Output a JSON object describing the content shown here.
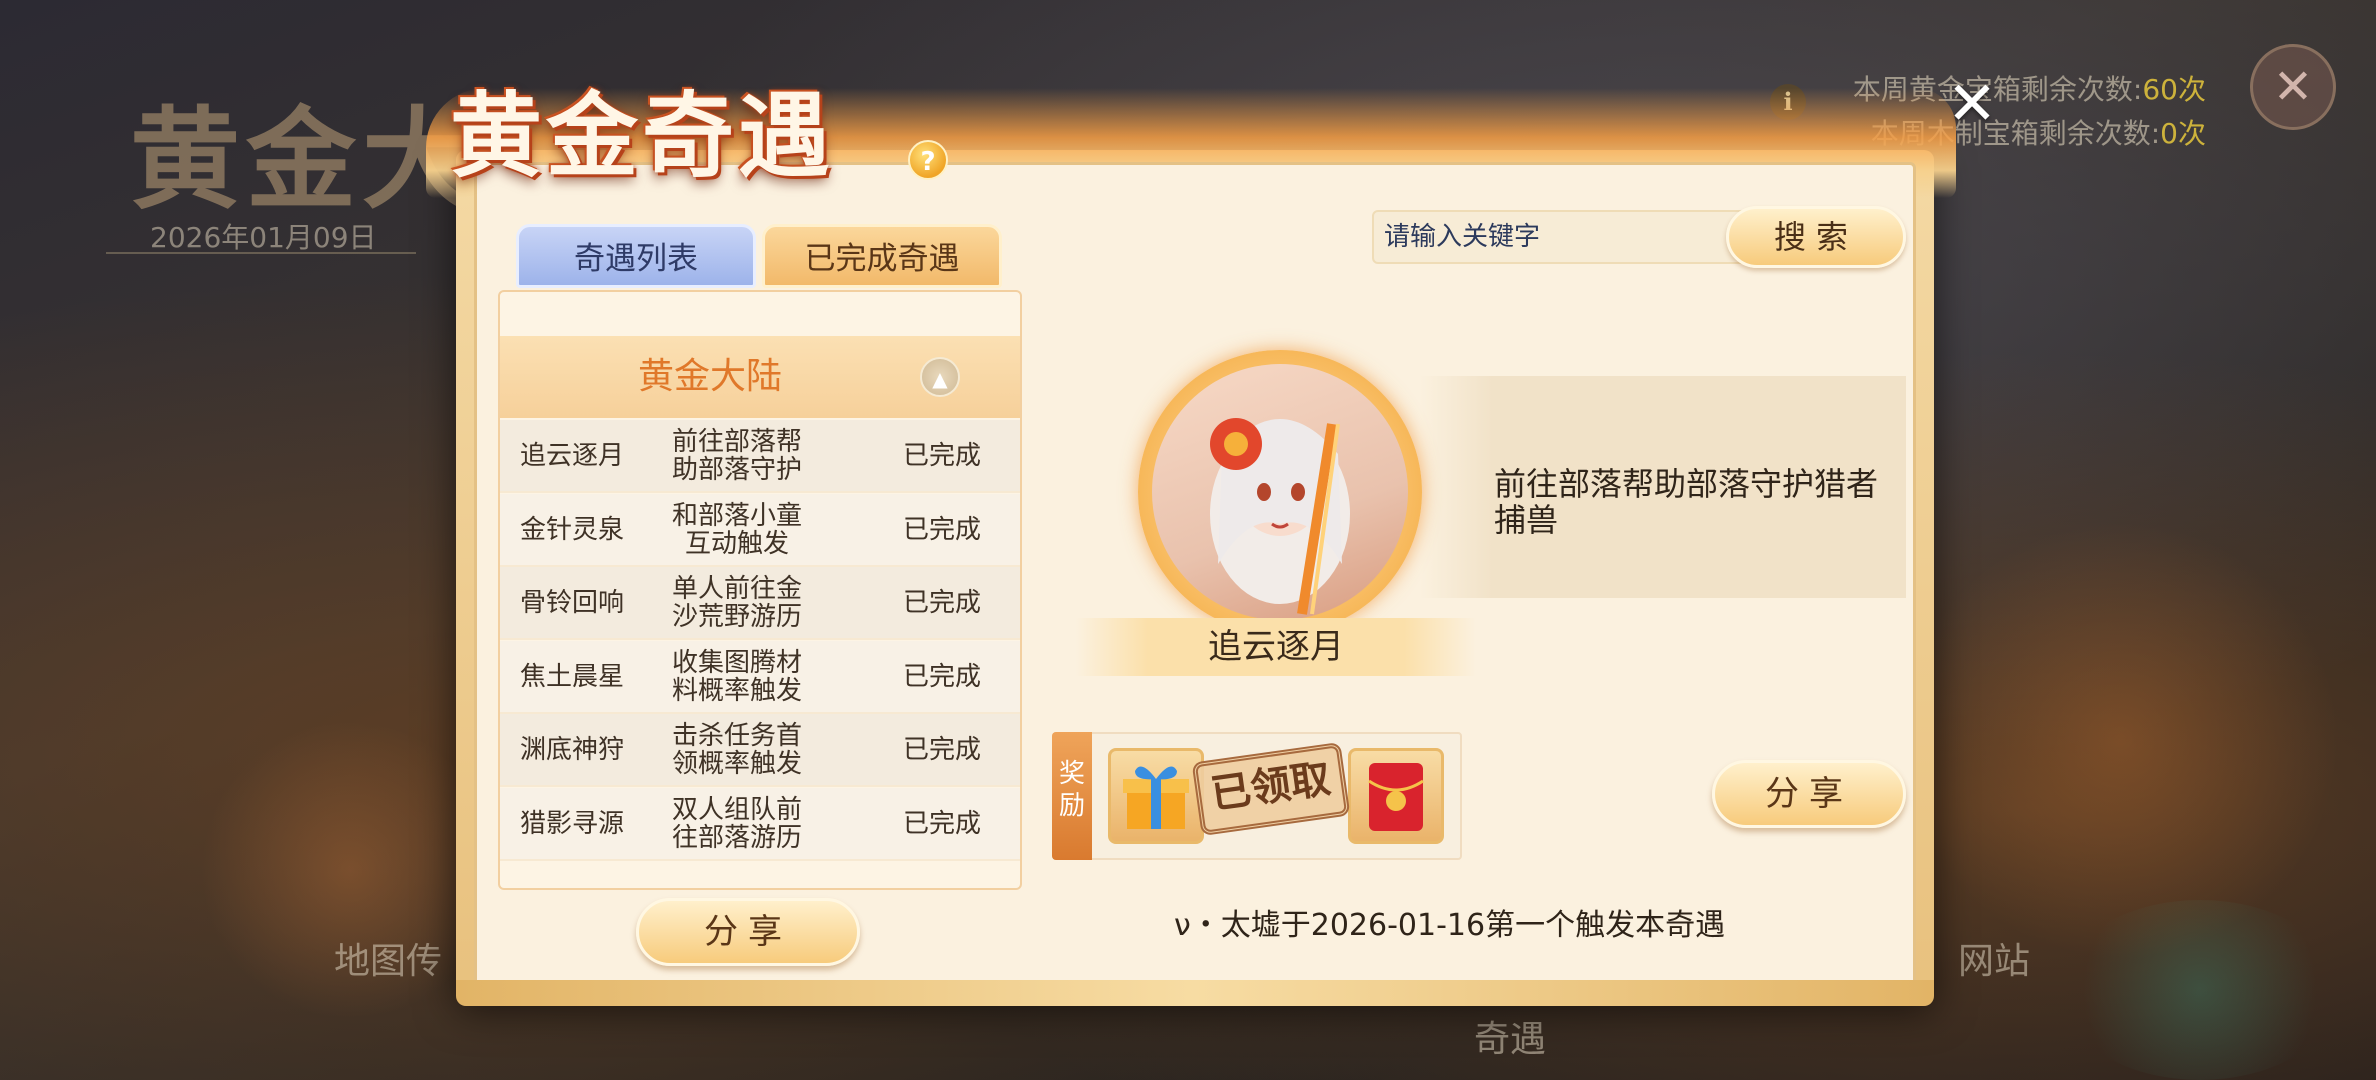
{
  "background": {
    "title": "黄金大",
    "date": "2026年01月09日",
    "counter_1_label": "本周黄金宝箱剩余次数:",
    "counter_1_value": "60次",
    "counter_2_label": "本周木制宝箱剩余次数:",
    "counter_2_value": "0次",
    "label_map": "地图传",
    "label_site": "网站",
    "label_qiyu": "奇遇"
  },
  "dialog": {
    "title": "黄金奇遇",
    "tabs": [
      {
        "label": "奇遇列表"
      },
      {
        "label": "已完成奇遇"
      }
    ],
    "region_label": "黄金大陆",
    "rows": [
      {
        "name": "追云逐月",
        "desc": "前往部落帮助部落守护",
        "status": "已完成"
      },
      {
        "name": "金针灵泉",
        "desc": "和部落小童互动触发",
        "status": "已完成"
      },
      {
        "name": "骨铃回响",
        "desc": "单人前往金沙荒野游历",
        "status": "已完成"
      },
      {
        "name": "焦土晨星",
        "desc": "收集图腾材料概率触发",
        "status": "已完成"
      },
      {
        "name": "渊底神狩",
        "desc": "击杀任务首领概率触发",
        "status": "已完成"
      },
      {
        "name": "猎影寻源",
        "desc": "双人组队前往部落游历",
        "status": "已完成"
      }
    ],
    "share_left_label": "分享",
    "search_placeholder": "请输入关键字",
    "search_button_label": "搜索",
    "selected_name": "追云逐月",
    "selected_description": "前往部落帮助部落守护猎者捕兽",
    "reward_tag": "奖励",
    "claimed_label": "已领取",
    "share_right_label": "分享",
    "trigger_text": "ν・太墟于2026-01-16第一个触发本奇遇"
  },
  "colors": {
    "accent_orange": "#e0782a",
    "tab_blue": "#9db3ea",
    "panel_cream": "#fbf1df"
  }
}
